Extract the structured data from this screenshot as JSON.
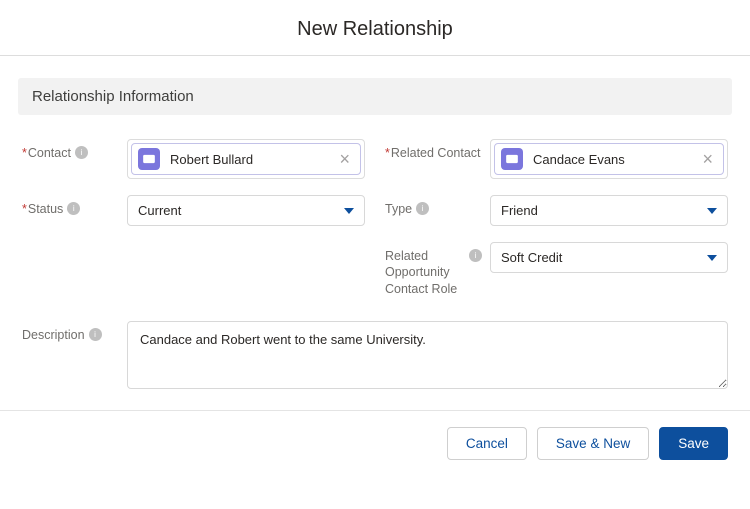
{
  "modal": {
    "title": "New Relationship"
  },
  "section": {
    "title": "Relationship Information"
  },
  "fields": {
    "contact": {
      "label": "Contact",
      "required": true,
      "value": "Robert Bullard"
    },
    "relatedContact": {
      "label": "Related Contact",
      "required": true,
      "value": "Candace Evans"
    },
    "status": {
      "label": "Status",
      "required": true,
      "value": "Current"
    },
    "type": {
      "label": "Type",
      "required": false,
      "value": "Friend"
    },
    "relatedRole": {
      "label": "Related Opportunity Contact Role",
      "required": false,
      "value": "Soft Credit"
    },
    "description": {
      "label": "Description",
      "required": false,
      "value": "Candace and Robert went to the same University."
    }
  },
  "footer": {
    "cancel": "Cancel",
    "saveNew": "Save & New",
    "save": "Save"
  }
}
